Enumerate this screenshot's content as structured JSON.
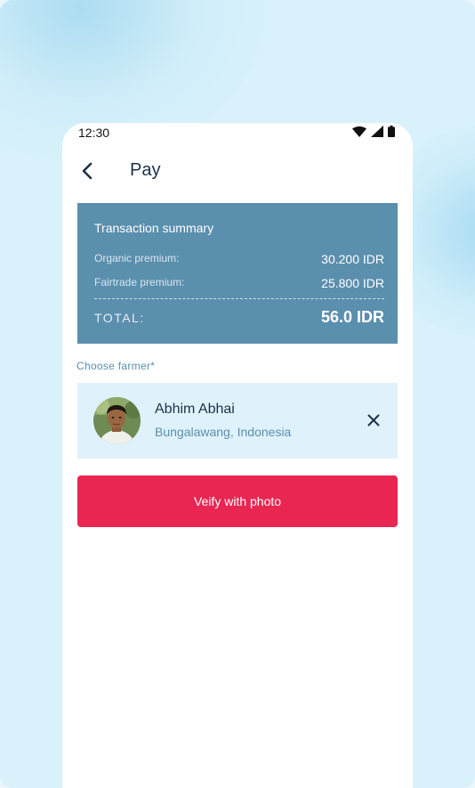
{
  "status_bar": {
    "time": "12:30",
    "icons": [
      "wifi-icon",
      "cell-signal-icon",
      "battery-icon"
    ]
  },
  "app_bar": {
    "back_icon": "chevron-left-icon",
    "title": "Pay"
  },
  "transaction_summary": {
    "title": "Transaction summary",
    "rows": [
      {
        "label": "Organic premium:",
        "value": "30.200 IDR"
      },
      {
        "label": "Fairtrade premium:",
        "value": "25.800 IDR"
      }
    ],
    "total_label": "TOTAL:",
    "total_value": "56.0 IDR"
  },
  "farmer_selection": {
    "label": "Choose farmer*",
    "selected": {
      "name": "Abhim Abhai",
      "location": "Bungalawang, Indonesia",
      "clear_icon": "close-icon"
    }
  },
  "actions": {
    "verify_label": "Veify with photo"
  },
  "colors": {
    "summary_card": "#5b8fae",
    "farmer_card": "#dff2fc",
    "primary_button": "#e82651",
    "title_text": "#1c3146",
    "accent_text": "#5b8fae"
  }
}
